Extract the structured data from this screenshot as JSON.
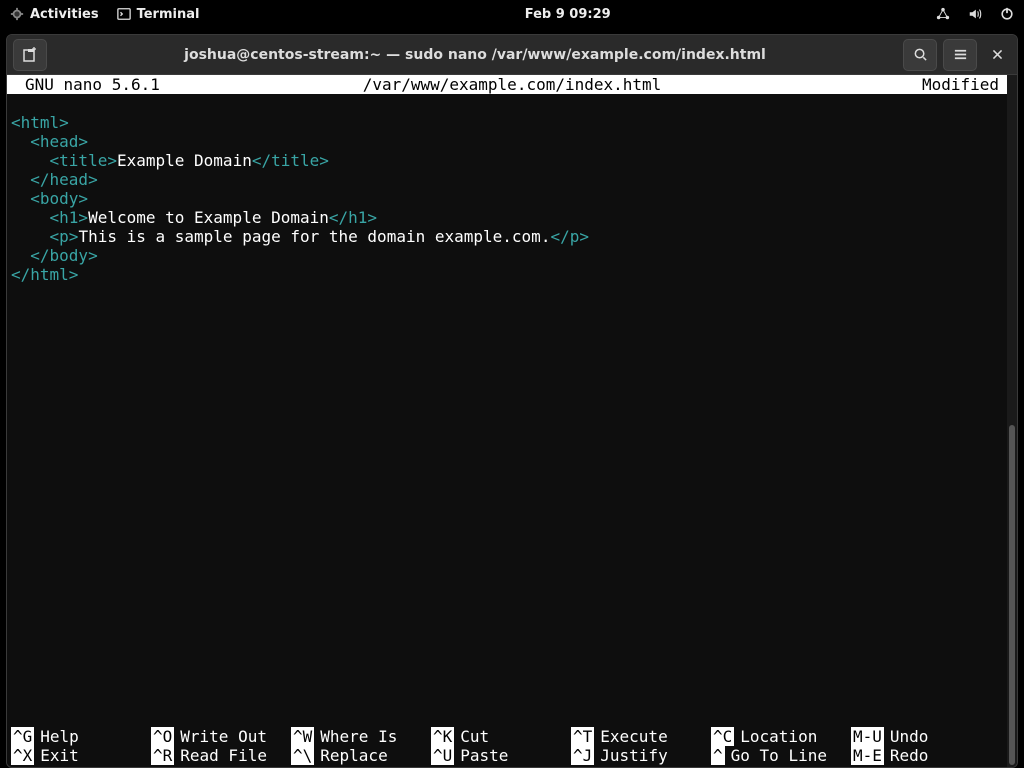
{
  "topbar": {
    "activities": "Activities",
    "app_label": "Terminal",
    "clock": "Feb 9  09:29"
  },
  "window": {
    "title": "joshua@centos-stream:~ — sudo nano /var/www/example.com/index.html"
  },
  "nano": {
    "app": "GNU nano 5.6.1",
    "file": "/var/www/example.com/index.html",
    "status": "Modified",
    "content": {
      "l1_open": "<html>",
      "l2_open": "  <head>",
      "l3_open": "    <title>",
      "l3_text": "Example Domain",
      "l3_close": "</title>",
      "l4_close": "  </head>",
      "l5_open": "  <body>",
      "l6_open": "    <h1>",
      "l6_text": "Welcome to Example Domain",
      "l6_close": "</h1>",
      "l7_open": "    <p>",
      "l7_text": "This is a sample page for the domain example.com.",
      "l7_close": "</p>",
      "l8_close": "  </body>",
      "l9_close": "</html>"
    }
  },
  "shortcuts": {
    "r1": [
      {
        "key": "^G",
        "label": "Help"
      },
      {
        "key": "^O",
        "label": "Write Out"
      },
      {
        "key": "^W",
        "label": "Where Is"
      },
      {
        "key": "^K",
        "label": "Cut"
      },
      {
        "key": "^T",
        "label": "Execute"
      },
      {
        "key": "^C",
        "label": "Location"
      },
      {
        "key": "M-U",
        "label": "Undo"
      }
    ],
    "r2": [
      {
        "key": "^X",
        "label": "Exit"
      },
      {
        "key": "^R",
        "label": "Read File"
      },
      {
        "key": "^\\",
        "label": "Replace"
      },
      {
        "key": "^U",
        "label": "Paste"
      },
      {
        "key": "^J",
        "label": "Justify"
      },
      {
        "key": "^ ",
        "label": "Go To Line"
      },
      {
        "key": "M-E",
        "label": "Redo"
      }
    ]
  }
}
